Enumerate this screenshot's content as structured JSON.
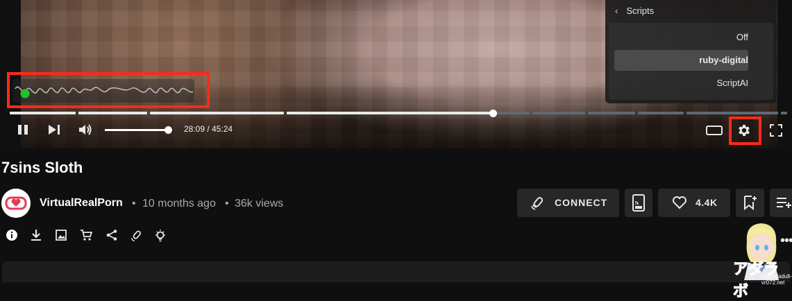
{
  "player": {
    "time_display": "28:09 / 45:24",
    "playback_progress": 0.621,
    "volume_level": 0.92,
    "settings_menu": {
      "title": "Scripts",
      "options": [
        "Off",
        "ruby-digital",
        "ScriptAI"
      ],
      "selected": "ruby-digital"
    }
  },
  "video": {
    "title": "7sins Sloth",
    "channel": "VirtualRealPorn",
    "age": "10 months ago",
    "views": "36k views",
    "separator": "•"
  },
  "actions": {
    "connect_label": "CONNECT",
    "like_count": "4.4K"
  },
  "icons": {
    "player": [
      "pause-icon",
      "next-icon",
      "volume-icon",
      "theater-mode-icon",
      "settings-icon",
      "fullscreen-icon"
    ],
    "actions": [
      "info-icon",
      "download-icon",
      "image-icon",
      "cart-icon",
      "share-icon",
      "toy-icon",
      "bulb-icon"
    ],
    "buttons": [
      "toy-connect-icon",
      "cast-icon",
      "heart-icon",
      "bookmark-add-icon",
      "playlist-add-icon"
    ]
  },
  "watermark": {
    "logo_text": "アダラボ",
    "url": "https://adult-vr072.net"
  },
  "colors": {
    "highlight": "#ff2a1a",
    "script_dot": "#22c12a",
    "brand": "#e8385a"
  }
}
